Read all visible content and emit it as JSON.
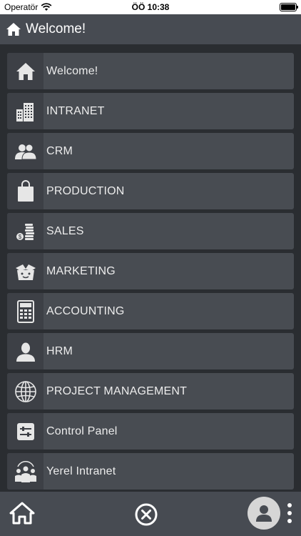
{
  "status_bar": {
    "carrier": "Operatör",
    "time": "ÖÖ 10:38"
  },
  "header": {
    "title": "Welcome!"
  },
  "menu": {
    "items": [
      {
        "label": "Welcome!",
        "icon": "home-icon"
      },
      {
        "label": "INTRANET",
        "icon": "buildings-icon"
      },
      {
        "label": "CRM",
        "icon": "users-icon"
      },
      {
        "label": "PRODUCTION",
        "icon": "shopping-bag-icon"
      },
      {
        "label": "SALES",
        "icon": "coins-icon"
      },
      {
        "label": "MARKETING",
        "icon": "gift-box-icon"
      },
      {
        "label": "ACCOUNTING",
        "icon": "calculator-icon"
      },
      {
        "label": "HRM",
        "icon": "person-icon"
      },
      {
        "label": "PROJECT MANAGEMENT",
        "icon": "globe-icon"
      },
      {
        "label": "Control Panel",
        "icon": "sliders-icon"
      },
      {
        "label": "Yerel Intranet",
        "icon": "team-icon"
      }
    ]
  },
  "bottom_bar": {
    "home": "home-icon",
    "close": "close-circle-icon",
    "avatar": "avatar-icon",
    "more": "more-vertical-icon"
  },
  "colors": {
    "header": "#474b52",
    "background": "#2a2d31",
    "item": "#484c52",
    "icon_box": "#3d4046",
    "text": "#ececec"
  }
}
